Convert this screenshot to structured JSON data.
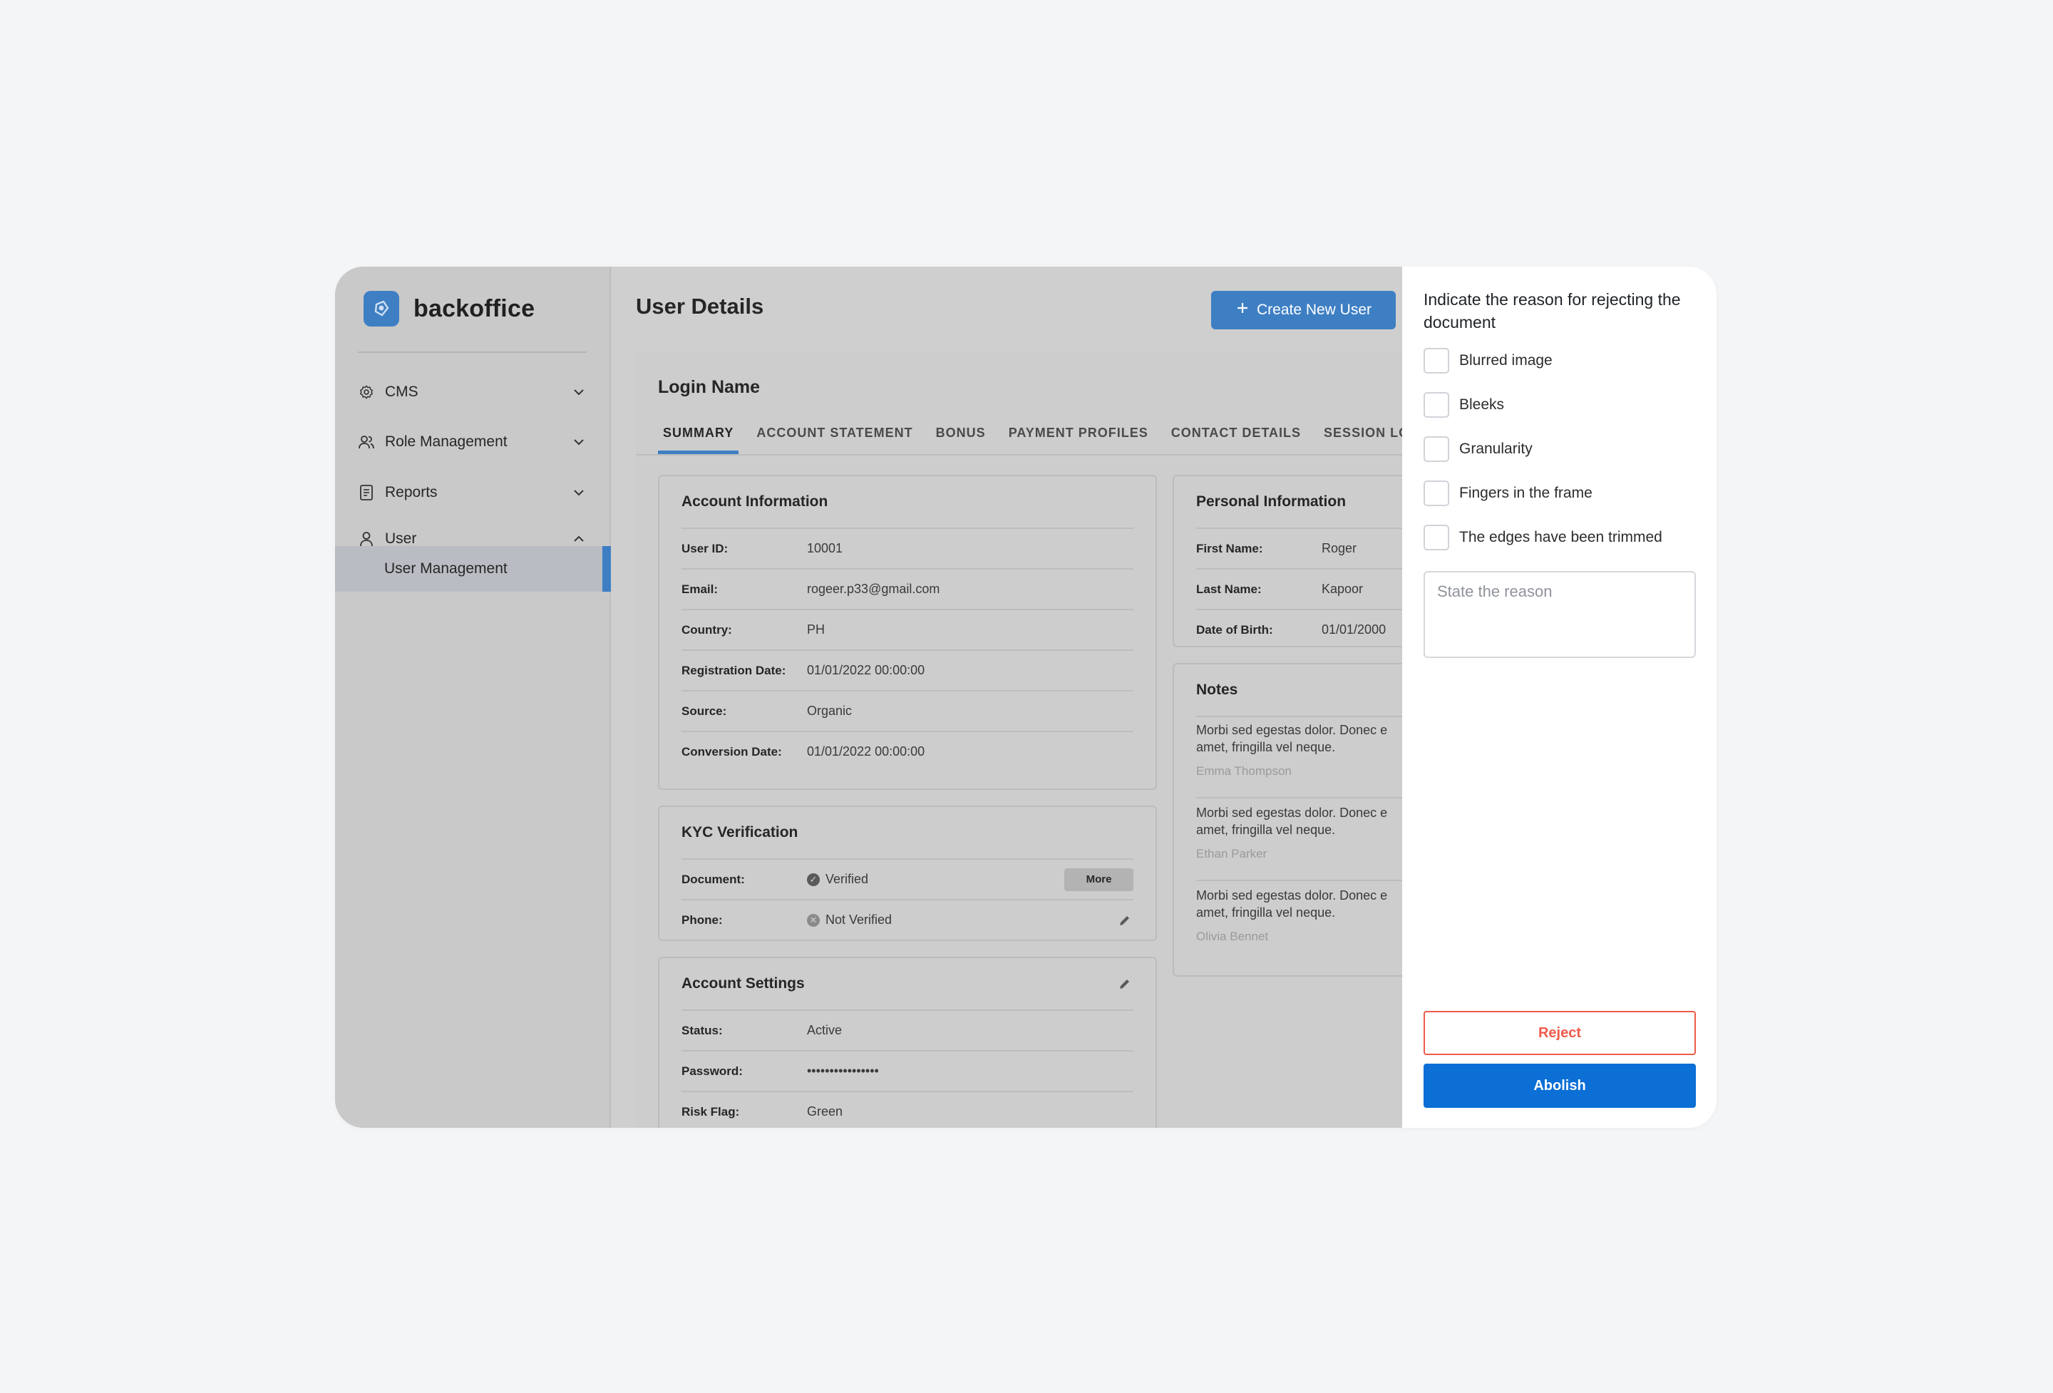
{
  "brand": {
    "name": "backoffice"
  },
  "sidebar": {
    "items": [
      {
        "label": "CMS",
        "icon": "gear-icon",
        "expanded": false
      },
      {
        "label": "Role Management",
        "icon": "users-icon",
        "expanded": false
      },
      {
        "label": "Reports",
        "icon": "report-icon",
        "expanded": false
      },
      {
        "label": "User",
        "icon": "user-icon",
        "expanded": true
      }
    ],
    "sub_items": [
      {
        "label": "User Management",
        "active": true
      }
    ]
  },
  "header": {
    "title": "User Details",
    "create_button": "Create New User"
  },
  "login": {
    "title": "Login Name"
  },
  "tabs": [
    "SUMMARY",
    "ACCOUNT STATEMENT",
    "BONUS",
    "PAYMENT PROFILES",
    "CONTACT DETAILS",
    "SESSION LO"
  ],
  "account_info": {
    "title": "Account Information",
    "rows": [
      {
        "k": "User ID:",
        "v": "10001"
      },
      {
        "k": "Email:",
        "v": "rogeer.p33@gmail.com"
      },
      {
        "k": "Country:",
        "v": "PH"
      },
      {
        "k": "Registration Date:",
        "v": "01/01/2022 00:00:00"
      },
      {
        "k": "Source:",
        "v": "Organic"
      },
      {
        "k": "Conversion Date:",
        "v": "01/01/2022 00:00:00"
      }
    ]
  },
  "kyc": {
    "title": "KYC Verification",
    "document_label": "Document:",
    "document_status": "Verified",
    "more_label": "More",
    "phone_label": "Phone:",
    "phone_status": "Not Verified"
  },
  "account_settings": {
    "title": "Account Settings",
    "rows": [
      {
        "k": "Status:",
        "v": "Active"
      },
      {
        "k": "Password:",
        "v": "••••••••••••••••"
      },
      {
        "k": "Risk Flag:",
        "v": "Green"
      }
    ]
  },
  "personal_info": {
    "title": "Personal Information",
    "rows": [
      {
        "k": "First Name:",
        "v": "Roger"
      },
      {
        "k": "Last Name:",
        "v": "Kapoor"
      },
      {
        "k": "Date of Birth:",
        "v": "01/01/2000"
      }
    ]
  },
  "notes": {
    "title": "Notes",
    "items": [
      {
        "line1": "Morbi sed egestas dolor. Donec e",
        "line2": "amet, fringilla vel neque.",
        "author": "Emma Thompson"
      },
      {
        "line1": "Morbi sed egestas dolor. Donec e",
        "line2": "amet, fringilla vel neque.",
        "author": "Ethan Parker"
      },
      {
        "line1": "Morbi sed egestas dolor. Donec e",
        "line2": "amet, fringilla vel neque.",
        "author": "Olivia Bennet"
      }
    ]
  },
  "drawer": {
    "title": "Indicate the reason for rejecting the document",
    "options": [
      "Blurred image",
      "Bleeks",
      "Granularity",
      "Fingers in the frame",
      "The edges have been trimmed"
    ],
    "reason_placeholder": "State the reason",
    "reject_label": "Reject",
    "abolish_label": "Abolish"
  },
  "colors": {
    "accent": "#3e7fc4",
    "primary_button": "#0b6fd6",
    "reject": "#ee5b4a",
    "overlay": "#cfcfcf"
  }
}
